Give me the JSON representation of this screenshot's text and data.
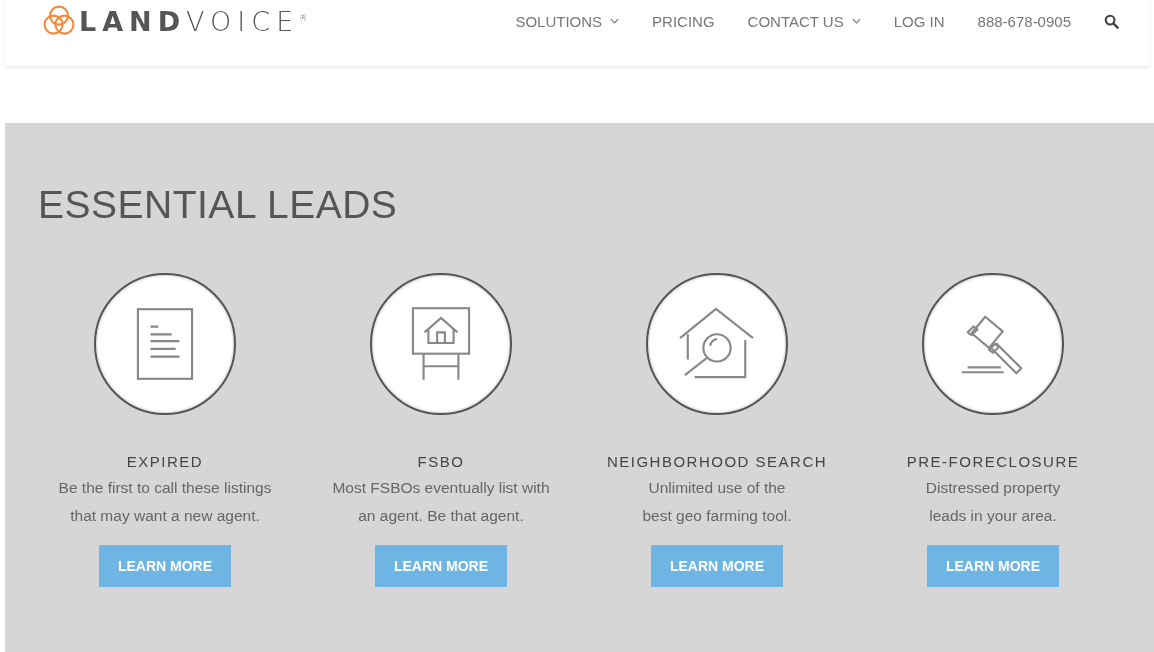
{
  "header": {
    "logo": "**LAND**VOICE$^{®}$",
    "nav": [
      {
        "label": "SOLUTIONS",
        "has_dropdown": true
      },
      {
        "label": "PRICING",
        "has_dropdown": false
      },
      {
        "label": "CONTACT US",
        "has_dropdown": true
      },
      {
        "label": "LOG IN",
        "has_dropdown": false
      },
      {
        "label": "888-678-0905",
        "has_dropdown": false
      }
    ]
  },
  "section": {
    "title": "ESSENTIAL LEADS",
    "leads": [
      {
        "kind": "document",
        "title": "EXPIRED",
        "lines": [
          "Be the first to call these listings",
          "that may want a new agent."
        ],
        "button": "LEARN MORE"
      },
      {
        "kind": "easel",
        "title": "FSBO",
        "lines": [
          "Most FSBOs eventually list with",
          "an agent. Be that agent."
        ],
        "button": "LEARN MORE"
      },
      {
        "kind": "house-search",
        "title": "NEIGHBORHOOD SEARCH",
        "lines": [
          "Unlimited use of the",
          "best geo farming tool."
        ],
        "button": "LEARN MORE"
      },
      {
        "kind": "gavel",
        "title": "PRE-FORECLOSURE",
        "lines": [
          "Distressed property",
          "leads in your area."
        ],
        "button": "LEARN MORE"
      }
    ]
  }
}
